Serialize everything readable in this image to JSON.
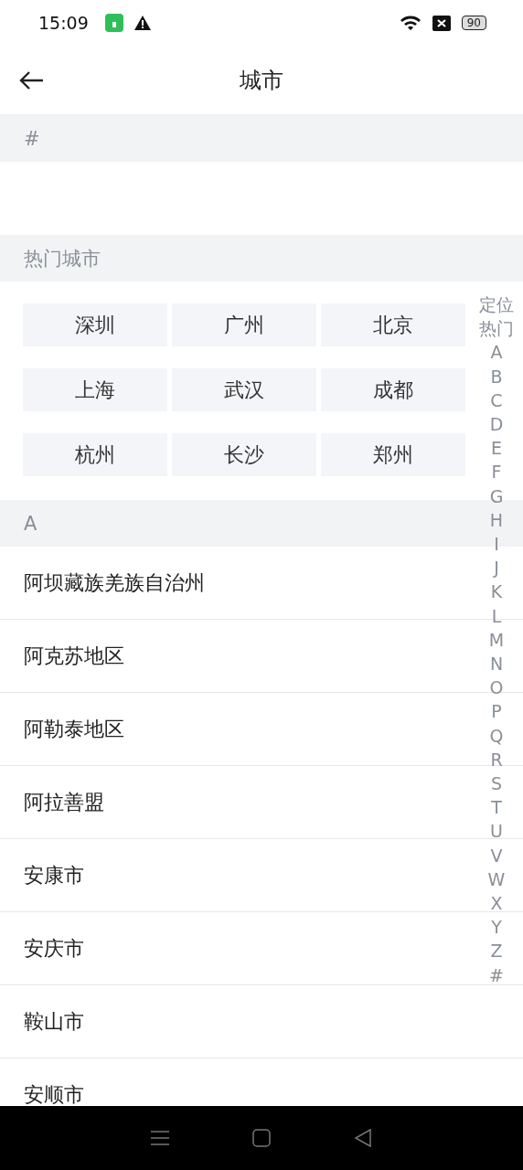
{
  "status_bar": {
    "time": "15:09",
    "battery": "90"
  },
  "header": {
    "title": "城市"
  },
  "sections": [
    {
      "kind": "empty",
      "title": "#"
    },
    {
      "kind": "grid",
      "title": "热门城市",
      "cities": [
        "深圳",
        "广州",
        "北京",
        "上海",
        "武汉",
        "成都",
        "杭州",
        "长沙",
        "郑州"
      ]
    },
    {
      "kind": "list",
      "title": "A",
      "cities": [
        "阿坝藏族羌族自治州",
        "阿克苏地区",
        "阿勒泰地区",
        "阿拉善盟",
        "安康市",
        "安庆市",
        "鞍山市",
        "安顺市"
      ]
    }
  ],
  "index": [
    "定位",
    "热门",
    "A",
    "B",
    "C",
    "D",
    "E",
    "F",
    "G",
    "H",
    "I",
    "J",
    "K",
    "L",
    "M",
    "N",
    "O",
    "P",
    "Q",
    "R",
    "S",
    "T",
    "U",
    "V",
    "W",
    "X",
    "Y",
    "Z",
    "#"
  ]
}
